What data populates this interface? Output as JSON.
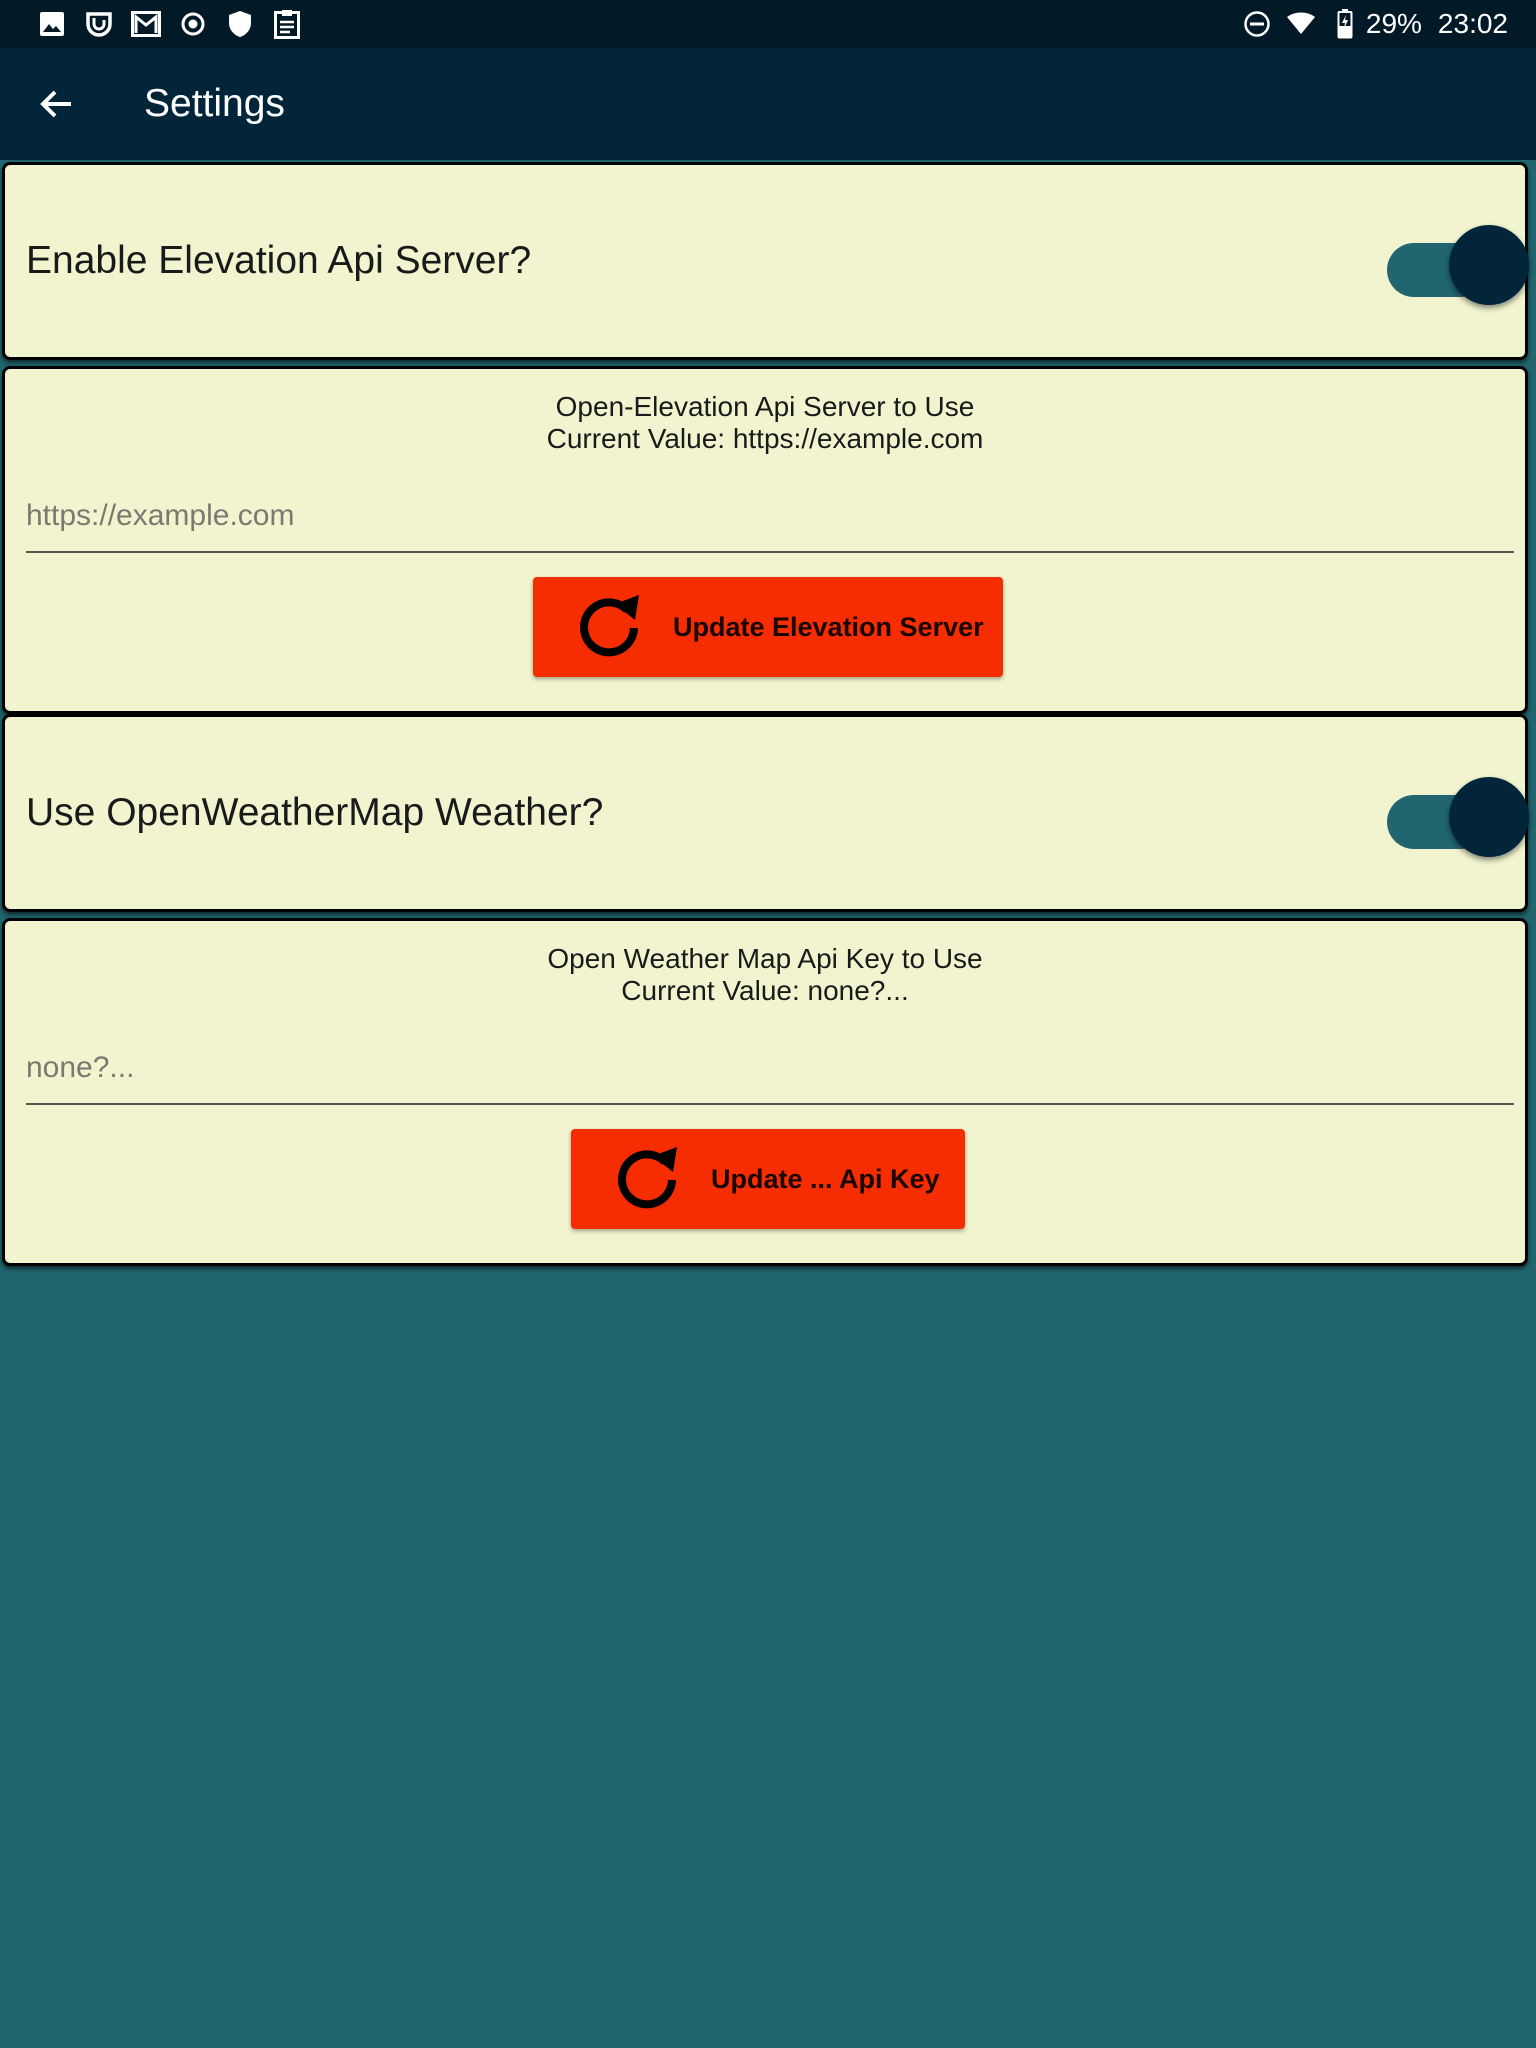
{
  "status_bar": {
    "notification_icons": [
      "image-icon",
      "logo-app-icon",
      "gmail-icon",
      "record-icon",
      "shield-icon",
      "clipboard-icon"
    ],
    "system_icons": [
      "do-not-disturb-icon",
      "wifi-icon",
      "battery-charging-icon"
    ],
    "battery": "29%",
    "time": "23:02"
  },
  "app_bar": {
    "title": "Settings",
    "back_icon": "arrow-back-icon"
  },
  "settings": {
    "elevation_toggle": {
      "label": "Enable Elevation Api Server?",
      "enabled": true
    },
    "elevation_server": {
      "caption_line1": "Open-Elevation Api Server to Use",
      "caption_line2": "Current Value: https://example.com",
      "placeholder": "https://example.com",
      "button_label": "Update Elevation Server",
      "button_icon": "refresh-icon"
    },
    "weather_toggle": {
      "label": "Use OpenWeatherMap Weather?",
      "enabled": true
    },
    "weather_key": {
      "caption_line1": "Open Weather Map Api Key to Use",
      "caption_line2": "Current Value: none?...",
      "placeholder": "none?...",
      "button_label": "Update ... Api Key",
      "button_icon": "refresh-icon"
    }
  },
  "colors": {
    "status_bar": "#021a28",
    "app_bar": "#02253a",
    "background": "#21666e",
    "card": "#f2f4d0",
    "button": "#f72d02",
    "switch_track": "#21666e",
    "switch_thumb": "#02253a"
  }
}
